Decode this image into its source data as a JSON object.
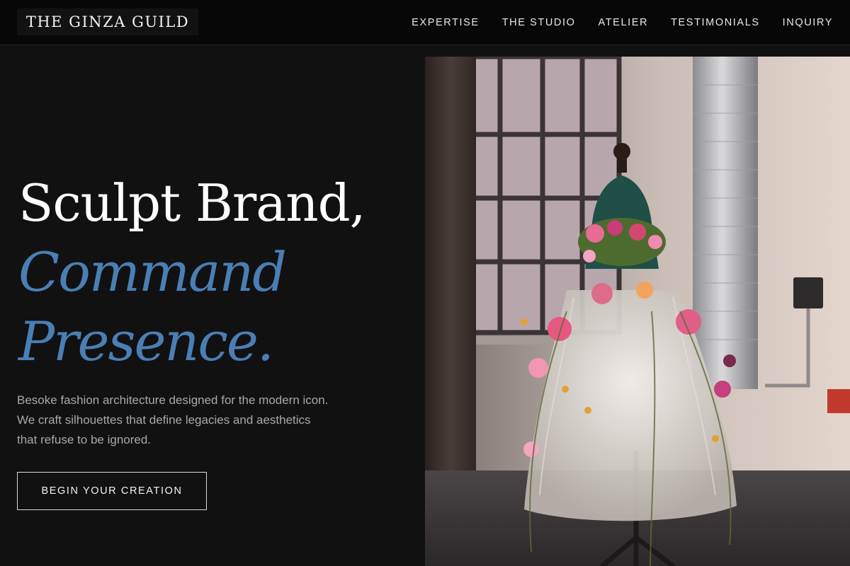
{
  "brand": {
    "name": "THE GINZA GUILD"
  },
  "nav": {
    "items": [
      {
        "label": "EXPERTISE"
      },
      {
        "label": "THE STUDIO"
      },
      {
        "label": "ATELIER"
      },
      {
        "label": "TESTIMONIALS"
      },
      {
        "label": "INQUIRY"
      }
    ]
  },
  "hero": {
    "title_line1": "Sculpt Brand,",
    "title_line2": "Command",
    "title_line3": "Presence.",
    "description": "Besoke fashion architecture designed for the modern icon. We craft silhouettes that define legacies and aesthetics that refuse to be ignored.",
    "cta_label": "BEGIN YOUR CREATION",
    "image_alt": "Floral dress on a dress form in a studio"
  },
  "colors": {
    "background": "#111112",
    "header": "#070707",
    "accent": "#4a7fb5",
    "text_muted": "#a8a8ac"
  }
}
